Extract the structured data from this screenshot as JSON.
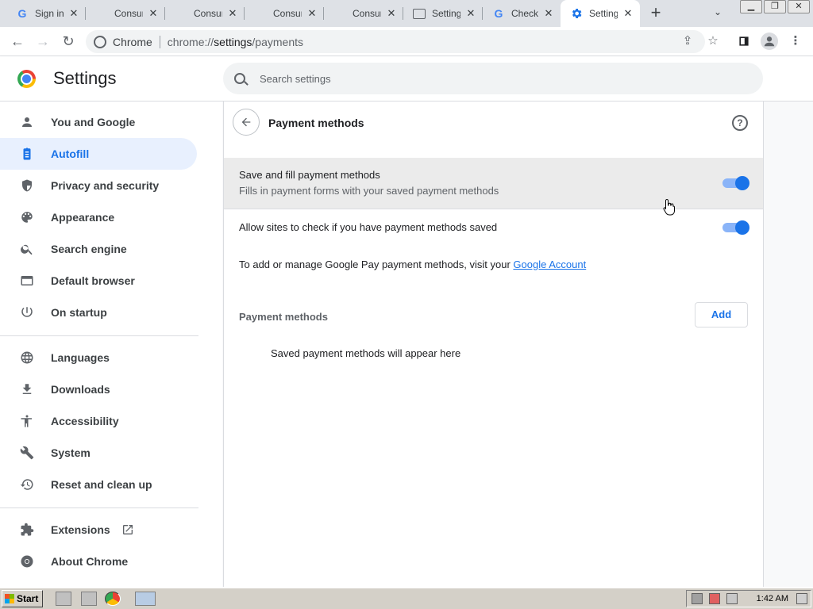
{
  "browser": {
    "tabs": [
      {
        "label": "Sign in",
        "icon": "google-g-icon"
      },
      {
        "label": "Consum",
        "icon": "microsoft-logo-icon"
      },
      {
        "label": "Consum",
        "icon": "microsoft-logo-icon"
      },
      {
        "label": "Consum",
        "icon": "microsoft-logo-icon"
      },
      {
        "label": "Consum",
        "icon": "microsoft-logo-icon"
      },
      {
        "label": "Setting",
        "icon": "page-icon"
      },
      {
        "label": "Check",
        "icon": "google-g-icon"
      },
      {
        "label": "Setting",
        "icon": "gear-icon",
        "active": true
      }
    ],
    "omnibox": {
      "site_name": "Chrome",
      "url_scheme": "chrome://",
      "url_host": "settings",
      "url_path": "/payments"
    }
  },
  "settings": {
    "title": "Settings",
    "search_placeholder": "Search settings",
    "nav": [
      {
        "label": "You and Google",
        "icon": "person-icon"
      },
      {
        "label": "Autofill",
        "icon": "clipboard-icon",
        "active": true
      },
      {
        "label": "Privacy and security",
        "icon": "shield-icon"
      },
      {
        "label": "Appearance",
        "icon": "palette-icon"
      },
      {
        "label": "Search engine",
        "icon": "search-icon"
      },
      {
        "label": "Default browser",
        "icon": "browser-window-icon"
      },
      {
        "label": "On startup",
        "icon": "power-icon"
      },
      {
        "label": "Languages",
        "icon": "globe-icon"
      },
      {
        "label": "Downloads",
        "icon": "download-icon"
      },
      {
        "label": "Accessibility",
        "icon": "accessibility-icon"
      },
      {
        "label": "System",
        "icon": "wrench-icon"
      },
      {
        "label": "Reset and clean up",
        "icon": "history-icon"
      },
      {
        "label": "Extensions",
        "icon": "puzzle-icon"
      },
      {
        "label": "About Chrome",
        "icon": "chrome-icon"
      }
    ]
  },
  "payments": {
    "page_title": "Payment methods",
    "save_fill_title": "Save and fill payment methods",
    "save_fill_sub": "Fills in payment forms with your saved payment methods",
    "save_fill_enabled": true,
    "allow_sites_title": "Allow sites to check if you have payment methods saved",
    "allow_sites_enabled": true,
    "gpay_text": "To add or manage Google Pay payment methods, visit your ",
    "gpay_link": "Google Account",
    "section_heading": "Payment methods",
    "add_label": "Add",
    "empty_text": "Saved payment methods will appear here"
  },
  "taskbar": {
    "start_label": "Start",
    "clock": "1:42 AM"
  },
  "colors": {
    "accent": "#1a73e8",
    "active_nav_bg": "#e8f0fe",
    "toggle_track": "#8ab4f8"
  }
}
